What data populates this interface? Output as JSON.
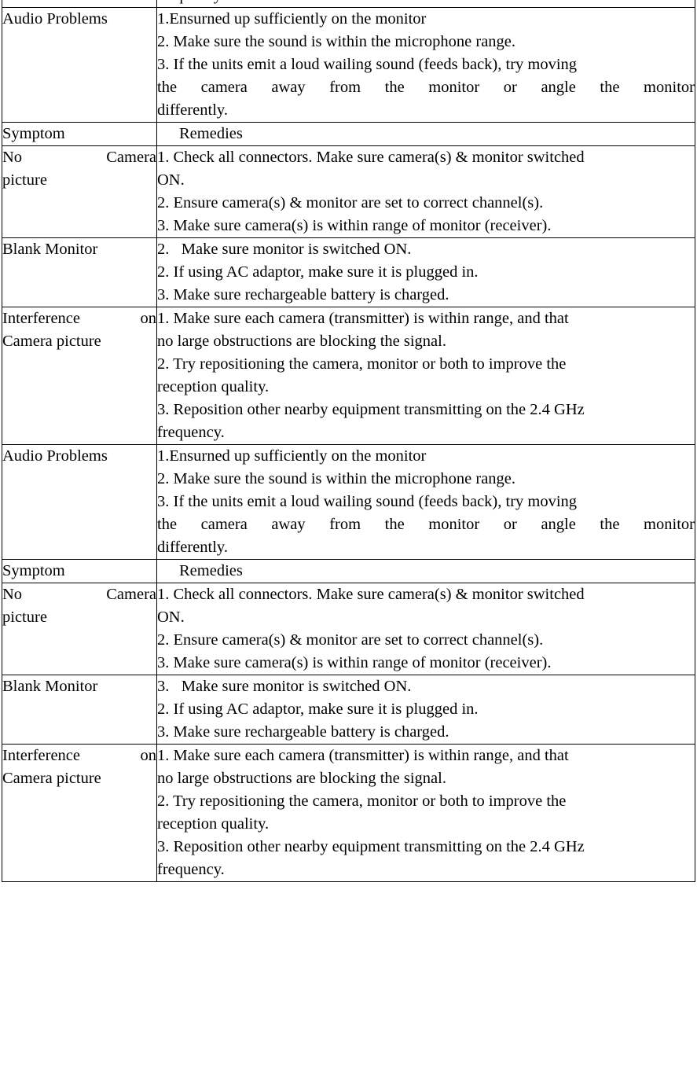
{
  "document": {
    "type": "troubleshooting-table",
    "columns": [
      "Symptom",
      "Remedies"
    ],
    "text": {
      "symptom_header": "Symptom",
      "remedies_header": "Remedies",
      "audio_problems": "Audio Problems",
      "no_camera_picture_w1": "No",
      "no_camera_picture_w2": "Camera",
      "no_camera_picture_l2": "picture",
      "blank_monitor": "Blank Monitor",
      "interference_w1": "Interference",
      "interference_w2": "on",
      "interference_l2": "Camera picture"
    },
    "remedies": {
      "interference": {
        "l1": "1. Make sure each camera (transmitter) is within range, and that",
        "l2": "no large obstructions are blocking the signal.",
        "l3": "2. Try repositioning the camera, monitor or both to improve the",
        "l4": "reception quality.",
        "l5": "3. Reposition other nearby equipment transmitting on the 2.4 GHz",
        "l6": "frequency."
      },
      "audio": {
        "l1": "1.Ensurned up sufficiently on the monitor",
        "l2": "2. Make sure the sound is within the microphone range.",
        "l3": "3. If the units emit a loud wailing sound (feeds back), try moving",
        "l4_w1": "the",
        "l4_w2": "camera",
        "l4_w3": "away",
        "l4_w4": "from",
        "l4_w5": "the",
        "l4_w6": "monitor",
        "l4_w7": "or",
        "l4_w8": "angle",
        "l4_w9": "the",
        "l4_w10": "monitor",
        "l5": "differently."
      },
      "no_camera": {
        "l1": "1. Check all connectors. Make sure camera(s) & monitor switched",
        "l2": "ON.",
        "l3": "2. Ensure camera(s) & monitor are set to correct channel(s).",
        "l4": "3. Make sure camera(s) is within range of monitor (receiver)."
      },
      "blank_monitor_first": {
        "l1": "2.   Make sure monitor is switched ON.",
        "l2": "2. If using AC adaptor, make sure it is plugged in.",
        "l3": "3. Make sure rechargeable battery is charged."
      },
      "blank_monitor_second": {
        "l1": "3.   Make sure monitor is switched ON.",
        "l2": "2. If using AC adaptor, make sure it is plugged in.",
        "l3": "3. Make sure rechargeable battery is charged."
      }
    }
  }
}
